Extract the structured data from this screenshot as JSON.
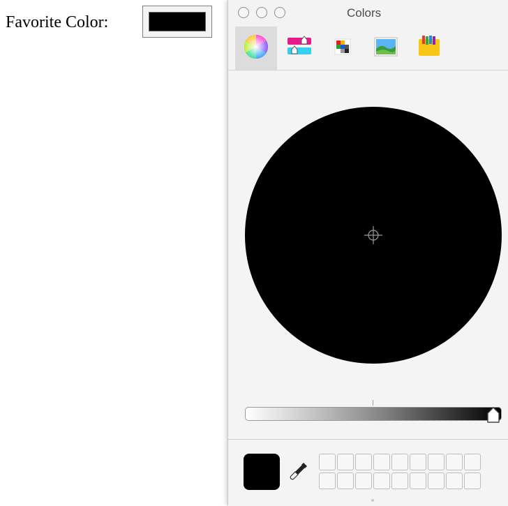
{
  "form": {
    "label": "Favorite Color:",
    "value_color": "#000000"
  },
  "panel": {
    "title": "Colors",
    "window_controls": [
      "close",
      "minimize",
      "zoom"
    ],
    "tabs": [
      {
        "icon": "color-wheel-icon",
        "selected": true
      },
      {
        "icon": "color-sliders-icon",
        "selected": false
      },
      {
        "icon": "color-palettes-icon",
        "selected": false
      },
      {
        "icon": "image-palettes-icon",
        "selected": false
      },
      {
        "icon": "crayons-icon",
        "selected": false
      }
    ],
    "wheel_color": "#000000",
    "brightness_level": 0.0,
    "current_color": "#000000",
    "swatch_slots": 18
  }
}
